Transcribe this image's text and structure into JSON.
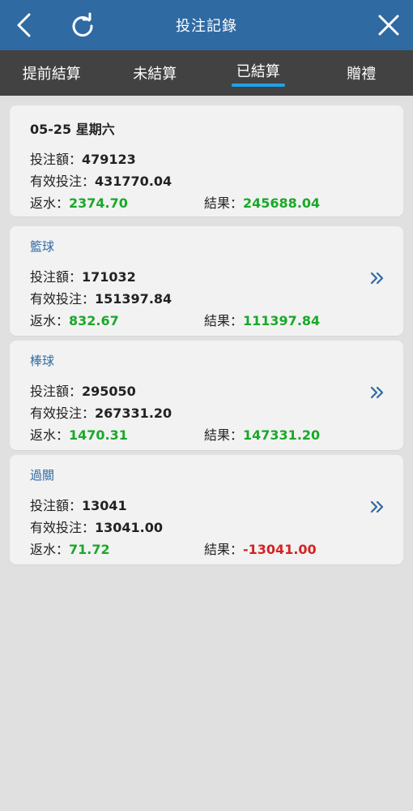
{
  "header": {
    "title": "投注記錄"
  },
  "tabs": [
    {
      "label": "提前結算",
      "active": false
    },
    {
      "label": "未結算",
      "active": false
    },
    {
      "label": "已結算",
      "active": true
    },
    {
      "label": "贈禮",
      "active": false
    }
  ],
  "labels": {
    "bet": "投注額：",
    "valid": "有效投注：",
    "rebate": "返水：",
    "result": "結果："
  },
  "summary": {
    "date": "05-25 星期六",
    "bet": "479123",
    "valid": "431770.04",
    "rebate": "2374.70",
    "result": "245688.04"
  },
  "categories": [
    {
      "name": "籃球",
      "bet": "171032",
      "valid": "151397.84",
      "rebate": "832.67",
      "result": "111397.84"
    },
    {
      "name": "棒球",
      "bet": "295050",
      "valid": "267331.20",
      "rebate": "1470.31",
      "result": "147331.20"
    },
    {
      "name": "過關",
      "bet": "13041",
      "valid": "13041.00",
      "rebate": "71.72",
      "result": "-13041.00"
    }
  ],
  "colors": {
    "header": "#2f6aa3",
    "tabbar": "#424242",
    "accent": "#1fa3e8",
    "positive": "#1aa829",
    "negative": "#d42323"
  }
}
